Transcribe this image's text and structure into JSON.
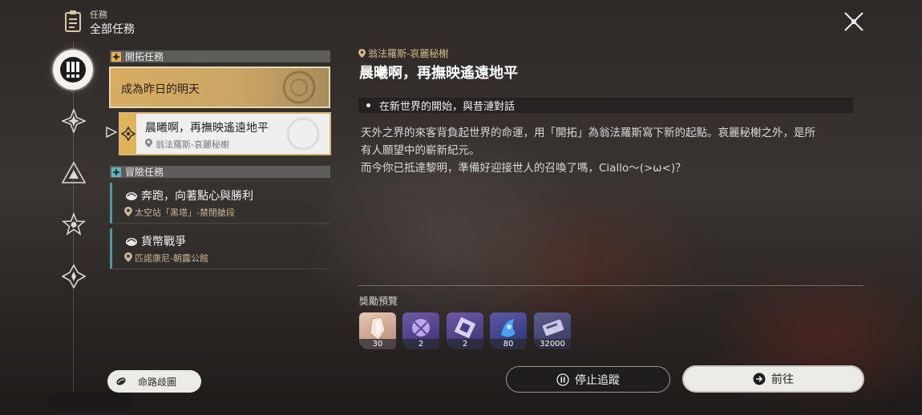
{
  "header": {
    "section_label": "任務",
    "title": "全部任務"
  },
  "icons": {
    "header": "quest-book-icon",
    "close": "close-icon",
    "rail": [
      "exclamation-icon",
      "compass-star-icon",
      "triangle-icon",
      "star-icon",
      "diamond-star-icon"
    ]
  },
  "sections": {
    "trailblaze": {
      "label": "開拓任務"
    },
    "adventure": {
      "label": "冒險任務"
    }
  },
  "trailblaze_quests": [
    {
      "title": "成為昨日的明天",
      "location": ""
    },
    {
      "title": "晨曦啊，再撫映遙遠地平",
      "location": "翁法羅斯-哀麗秘榭"
    }
  ],
  "adventure_quests": [
    {
      "title": "奔跑，向著點心與勝利",
      "location": "太空站「黑塔」-禁閉艙段"
    },
    {
      "title": "貨幣戰爭",
      "location": "匹諾康尼-朝露公館"
    }
  ],
  "flow_button": {
    "label": "命路歧圖"
  },
  "detail": {
    "location": "翁法羅斯-哀麗秘榭",
    "title": "晨曦啊，再撫映遙遠地平",
    "objective": "在新世界的開始，與昔漣對話",
    "description_lines": [
      "天外之界的來客背負起世界的命運，用「開拓」為翁法羅斯寫下新的起點。哀麗秘榭之外，是所",
      "有人願望中的嶄新紀元。",
      "而今你已抵達黎明，準備好迎接世人的召喚了嗎，Ciallo～(>ω<)？"
    ],
    "rewards_label": "獎勵預覽",
    "rewards": [
      {
        "icon": "crystal-icon",
        "count": "30"
      },
      {
        "icon": "material-orb-icon",
        "count": "2"
      },
      {
        "icon": "material-cube-icon",
        "count": "2"
      },
      {
        "icon": "blue-fluid-icon",
        "count": "80"
      },
      {
        "icon": "credit-icon",
        "count": "32000"
      }
    ]
  },
  "actions": {
    "stop_tracking": "停止追蹤",
    "go": "前往"
  }
}
